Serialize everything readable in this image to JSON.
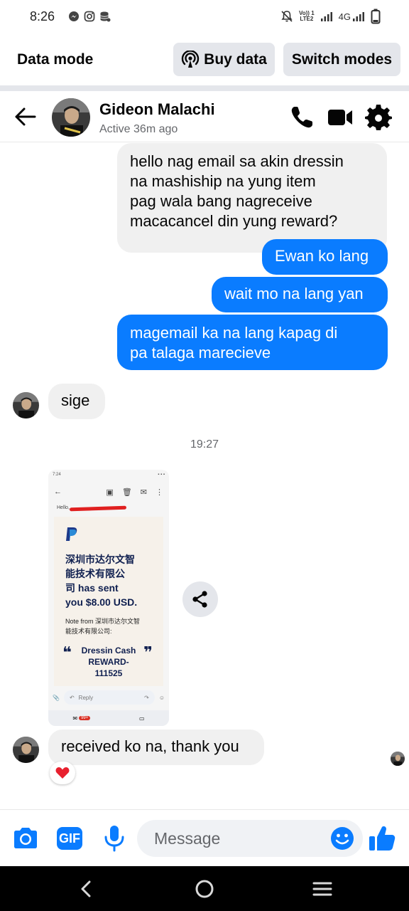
{
  "status_bar": {
    "time": "8:26",
    "left_icons": [
      "messenger-icon",
      "instagram-icon",
      "database-icon"
    ],
    "right_icons": [
      "mute-icon",
      "volte-icon",
      "signal-icon",
      "4g-signal-icon",
      "battery-icon"
    ],
    "volte_top": "Vo)) 1",
    "volte_bottom": "LTE2",
    "network_label": "4G"
  },
  "data_bar": {
    "title": "Data mode",
    "buy_label": "Buy data",
    "switch_label": "Switch modes"
  },
  "chat_header": {
    "name": "Gideon Malachi",
    "status": "Active 36m ago",
    "actions": [
      "phone-icon",
      "video-icon",
      "settings-icon"
    ]
  },
  "messages": [
    {
      "direction": "in",
      "text_lines": [
        "hello nag email sa akin dressin",
        "na mashiship na yung item",
        "pag wala bang nagreceive",
        "macacancel din yung reward?"
      ]
    },
    {
      "direction": "out",
      "text": "Ewan ko lang"
    },
    {
      "direction": "out",
      "text": "wait mo na lang yan"
    },
    {
      "direction": "out",
      "text_lines": [
        "magemail ka na lang kapag di",
        "pa talaga marecieve"
      ]
    },
    {
      "direction": "in",
      "text": "sige"
    },
    {
      "direction": "in",
      "text": "received ko na, thank you",
      "reaction": "❤️"
    }
  ],
  "timestamp": "19:27",
  "shared_image": {
    "status_time": "7:24",
    "hello": "Hello,",
    "sent_text_lines": [
      "深圳市达尔文智",
      "能技术有限公",
      "司 has sent",
      "you $8.00 USD."
    ],
    "note_lines": [
      "Note from 深圳市达尔文智",
      "能技术有限公司:"
    ],
    "quote_lines": [
      "Dressin Cash",
      "REWARD-",
      "111525"
    ],
    "reply_label": "Reply",
    "badge": "99+"
  },
  "composer": {
    "placeholder": "Message",
    "value": "",
    "icons": [
      "camera-icon",
      "gif-icon",
      "microphone-icon",
      "emoji-icon",
      "thumbs-up-icon"
    ],
    "gif_label": "GIF"
  },
  "colors": {
    "accent": "#0a7cff",
    "incoming_bubble": "#f0f0f0",
    "text": "#050505",
    "secondary_text": "#65676b"
  }
}
